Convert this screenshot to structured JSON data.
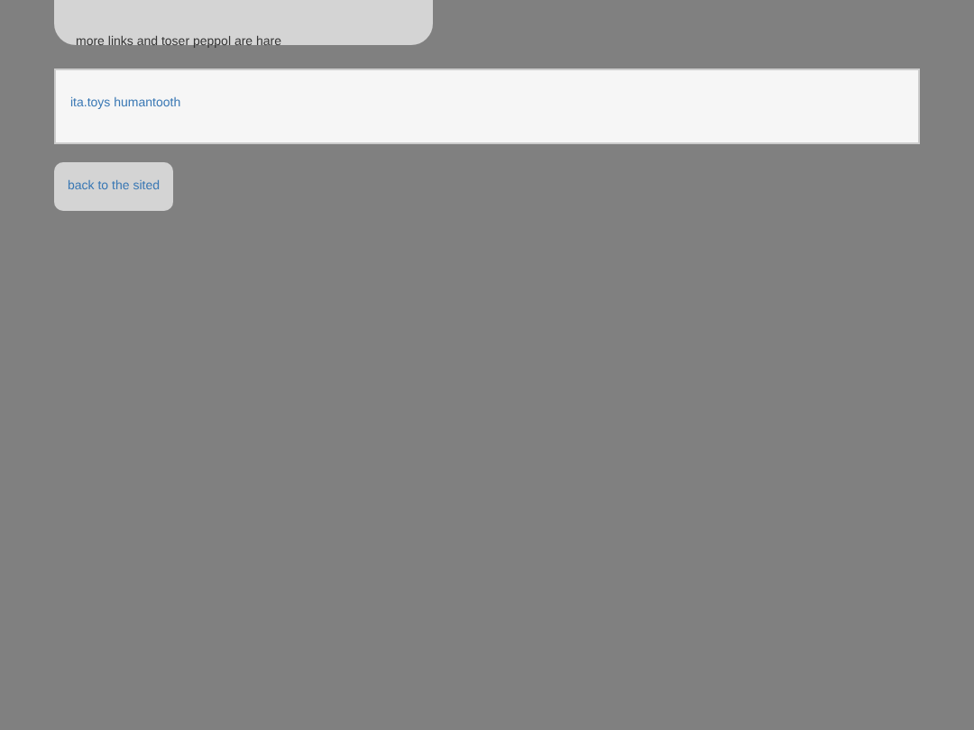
{
  "notice": {
    "text": "more links and toser peppol are hare"
  },
  "links_panel": {
    "links": [
      "ita.toys humantooth"
    ]
  },
  "back_button": {
    "label": "back to the sited"
  }
}
